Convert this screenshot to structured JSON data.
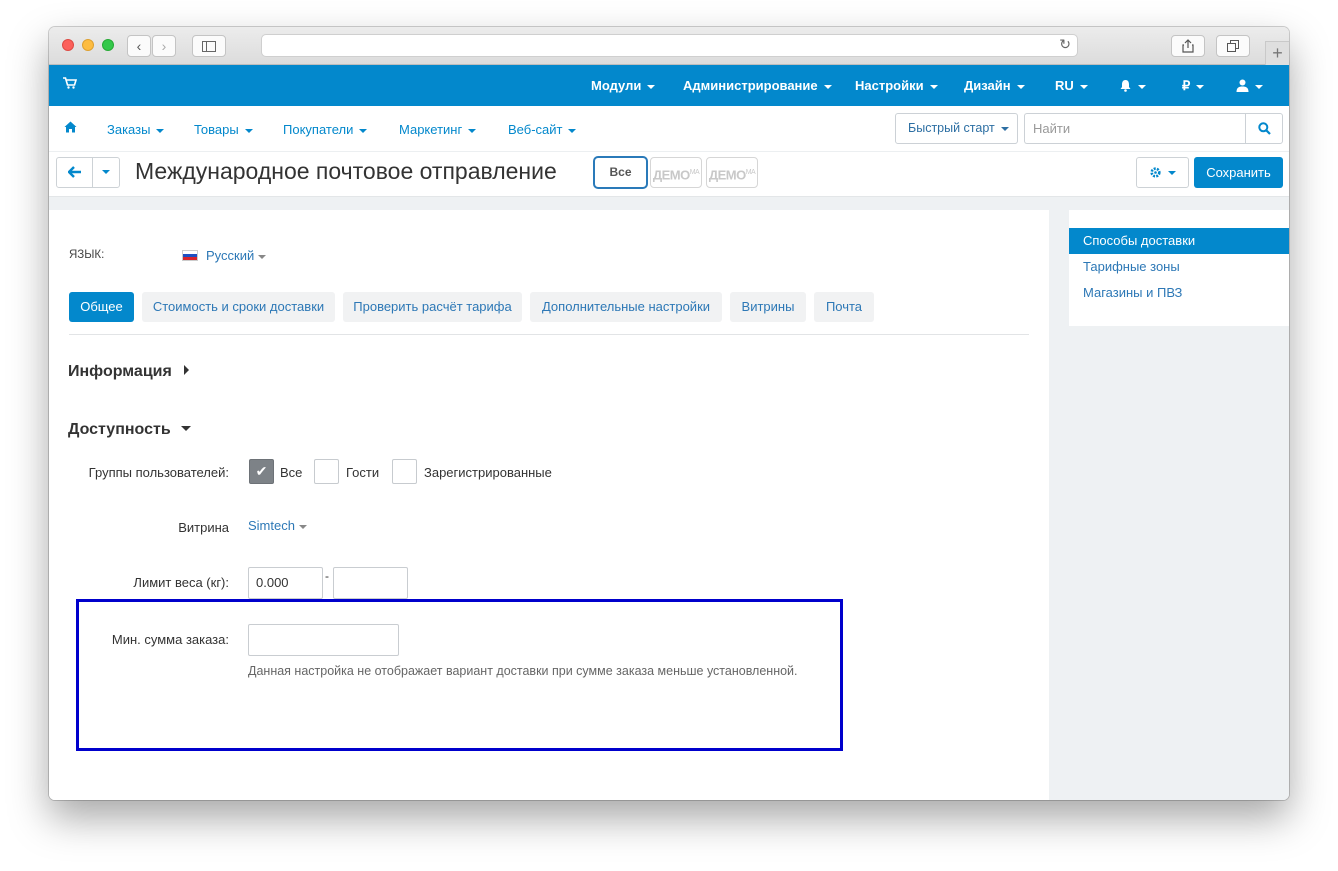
{
  "topbar": {
    "items": [
      {
        "label": "Модули"
      },
      {
        "label": "Администрирование"
      },
      {
        "label": "Настройки"
      },
      {
        "label": "Дизайн"
      },
      {
        "label": "RU"
      },
      {
        "label": "₽"
      }
    ]
  },
  "nav": {
    "items": [
      {
        "label": "Заказы"
      },
      {
        "label": "Товары"
      },
      {
        "label": "Покупатели"
      },
      {
        "label": "Маркетинг"
      },
      {
        "label": "Веб-сайт"
      }
    ],
    "quick_start": "Быстрый старт",
    "search_placeholder": "Найти"
  },
  "titlebar": {
    "title": "Международное почтовое отправление",
    "all_label": "Все",
    "demo_label": "ДЕМО",
    "demo_sup": "МА",
    "save_label": "Сохранить"
  },
  "sidebar": {
    "items": [
      {
        "label": "Способы доставки",
        "active": true
      },
      {
        "label": "Тарифные зоны",
        "active": false
      },
      {
        "label": "Магазины и ПВЗ",
        "active": false
      }
    ]
  },
  "language": {
    "label": "ЯЗЫК:",
    "value": "Русский"
  },
  "tabs": [
    {
      "label": "Общее",
      "active": true
    },
    {
      "label": "Стоимость и сроки доставки",
      "active": false
    },
    {
      "label": "Проверить расчёт тарифа",
      "active": false
    },
    {
      "label": "Дополнительные настройки",
      "active": false
    },
    {
      "label": "Витрины",
      "active": false
    },
    {
      "label": "Почта",
      "active": false
    }
  ],
  "sections": {
    "info": "Информация",
    "availability": "Доступность"
  },
  "form": {
    "groups_label": "Группы пользователей:",
    "groups": [
      {
        "label": "Все",
        "checked": true
      },
      {
        "label": "Гости",
        "checked": false
      },
      {
        "label": "Зарегистрированные",
        "checked": false
      }
    ],
    "storefront_label": "Витрина",
    "storefront_value": "Simtech",
    "weight_label": "Лимит веса (кг):",
    "weight_from": "0.000",
    "weight_sep": "-",
    "weight_to": "",
    "min_sum_label": "Мин. сумма заказа:",
    "min_sum_value": "",
    "min_sum_hint": "Данная настройка не отображает вариант доставки при сумме заказа меньше установленной."
  },
  "colors": {
    "primary": "#0388cc",
    "highlight": "#0000cc"
  }
}
